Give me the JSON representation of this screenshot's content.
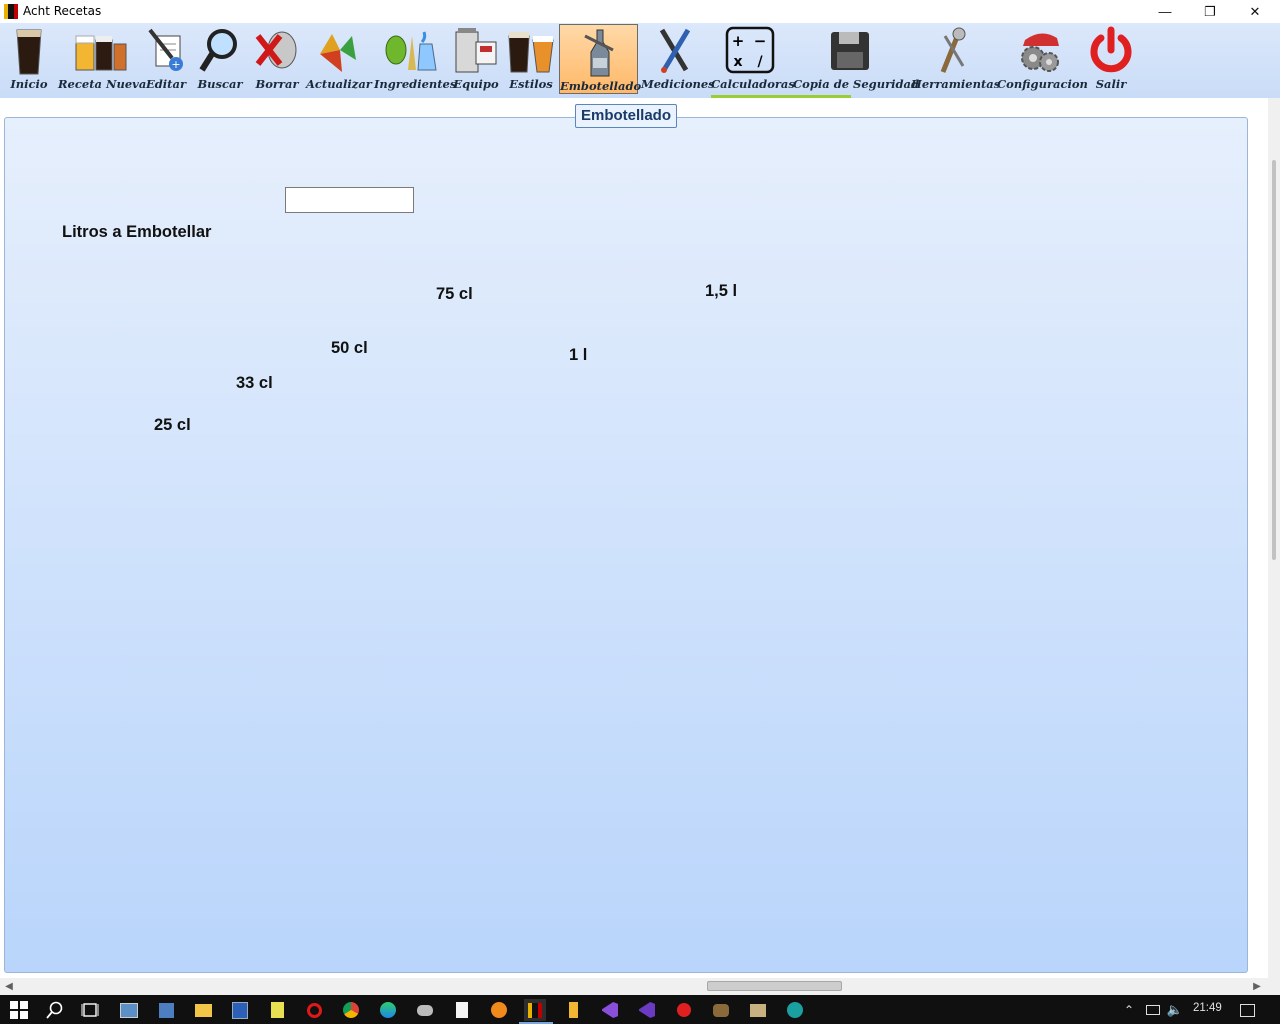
{
  "window": {
    "title": "Acht Recetas"
  },
  "toolbar": {
    "items": [
      {
        "label": "Inicio",
        "icon": "stout-glass-icon"
      },
      {
        "label": "Receta Nueva",
        "icon": "beer-mugs-icon"
      },
      {
        "label": "Editar",
        "icon": "edit-pencil-icon"
      },
      {
        "label": "Buscar",
        "icon": "magnifier-icon"
      },
      {
        "label": "Borrar",
        "icon": "delete-keg-icon"
      },
      {
        "label": "Actualizar",
        "icon": "refresh-icon"
      },
      {
        "label": "Ingredientes",
        "icon": "hops-grain-icon"
      },
      {
        "label": "Equipo",
        "icon": "brew-equipment-icon"
      },
      {
        "label": "Estilos",
        "icon": "beer-styles-icon"
      },
      {
        "label": "Embotellado",
        "icon": "bottling-icon"
      },
      {
        "label": "Mediciones",
        "icon": "measurement-tools-icon"
      },
      {
        "label": "Calculadoras",
        "icon": "calculator-icon"
      },
      {
        "label": "Copia de Seguridad",
        "icon": "floppy-disk-icon"
      },
      {
        "label": "Herramientas",
        "icon": "tools-icon"
      },
      {
        "label": "Configuracion",
        "icon": "settings-gears-icon"
      },
      {
        "label": "Salir",
        "icon": "power-icon"
      }
    ],
    "active": "Embotellado"
  },
  "panel": {
    "title": "Embotellado",
    "liters_label": "Litros a Embotellar",
    "liters_value": "",
    "bottles": {
      "cl25": "25 cl",
      "cl33": "33 cl",
      "cl50": "50 cl",
      "cl75": "75 cl",
      "l1": "1 l",
      "l15": "1,5 l"
    }
  },
  "taskbar": {
    "time": "21:49"
  },
  "colors": {
    "accent_underline": "#9acd32",
    "active_button": "#ffb868",
    "panel_gradient_top": "#e6effc",
    "panel_gradient_bottom": "#b9d5fb"
  }
}
